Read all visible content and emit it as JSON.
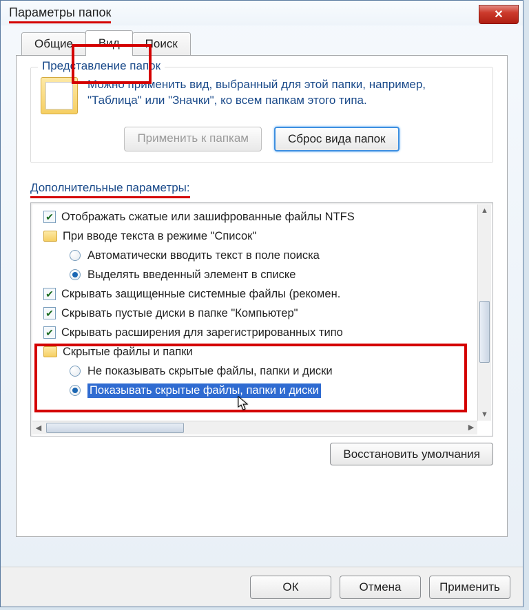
{
  "window": {
    "title": "Параметры папок"
  },
  "tabs": {
    "general": "Общие",
    "view": "Вид",
    "search": "Поиск"
  },
  "group": {
    "label": "Представление папок",
    "text": "Можно применить вид, выбранный для этой папки, например, \"Таблица\" или \"Значки\", ко всем папкам этого типа.",
    "apply_btn": "Применить к папкам",
    "reset_btn": "Сброс вида папок"
  },
  "advanced": {
    "label": "Дополнительные параметры:",
    "items": {
      "ntfs": "Отображать сжатые или зашифрованные файлы NTFS",
      "list_mode": "При вводе текста в режиме \"Список\"",
      "auto_search": "Автоматически вводить текст в поле поиска",
      "highlight_sel": "Выделять введенный элемент в списке",
      "hide_protected": "Скрывать защищенные системные файлы (рекомен.",
      "hide_empty": "Скрывать пустые диски в папке \"Компьютер\"",
      "hide_ext": "Скрывать расширения для зарегистрированных типо",
      "hidden_folder": "Скрытые файлы и папки",
      "dont_show": "Не показывать скрытые файлы, папки и диски",
      "show_hidden": "Показывать скрытые файлы, папки и диски"
    },
    "restore_btn": "Восстановить умолчания"
  },
  "buttons": {
    "ok": "ОК",
    "cancel": "Отмена",
    "apply": "Применить"
  }
}
